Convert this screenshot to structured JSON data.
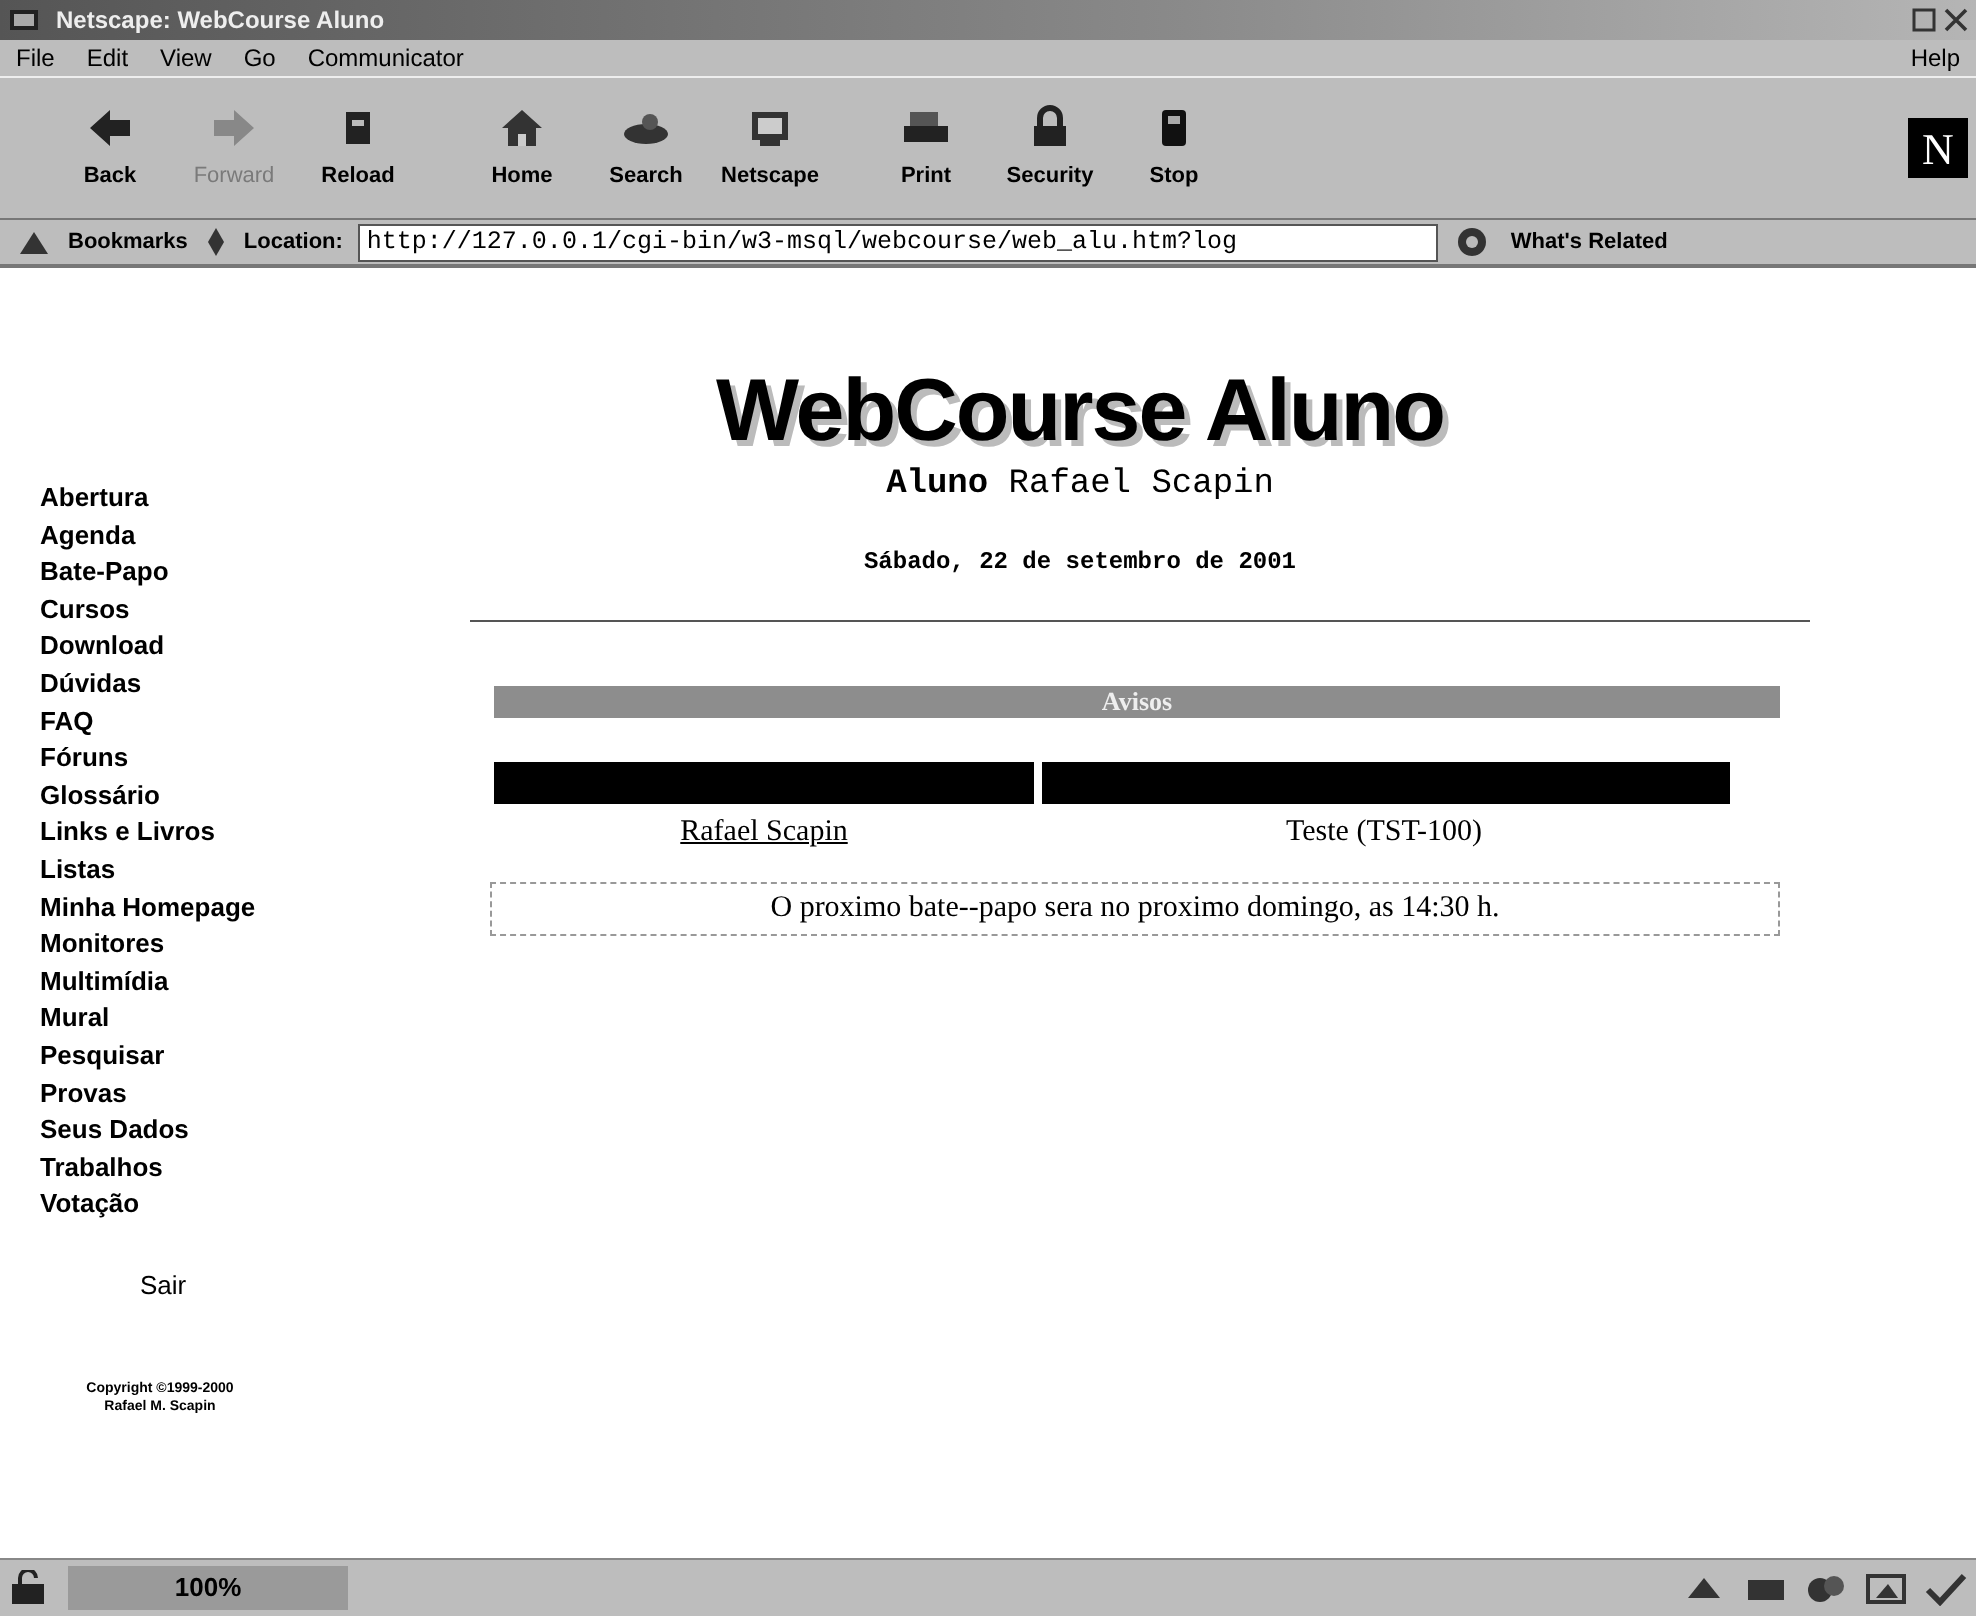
{
  "window": {
    "title": "Netscape: WebCourse Aluno"
  },
  "menu": [
    "File",
    "Edit",
    "View",
    "Go",
    "Communicator"
  ],
  "help_menu": "Help",
  "toolbar": [
    {
      "label": "Back",
      "disabled": false
    },
    {
      "label": "Forward",
      "disabled": true
    },
    {
      "label": "Reload",
      "disabled": false
    },
    {
      "label": "Home",
      "disabled": false
    },
    {
      "label": "Search",
      "disabled": false
    },
    {
      "label": "Netscape",
      "disabled": false
    },
    {
      "label": "Print",
      "disabled": false
    },
    {
      "label": "Security",
      "disabled": false
    },
    {
      "label": "Stop",
      "disabled": false
    }
  ],
  "logo": "N",
  "location_bar": {
    "bookmarks": "Bookmarks",
    "location_label": "Location:",
    "url": "http://127.0.0.1/cgi-bin/w3-msql/webcourse/web_alu.htm?log",
    "related": "What's Related"
  },
  "page": {
    "heading": "WebCourse Aluno",
    "student_label": "Aluno",
    "student_name": "Rafael Scapin",
    "date": "Sábado, 22 de setembro de 2001",
    "nav": [
      "Abertura",
      "Agenda",
      "Bate-Papo",
      "Cursos",
      "Download",
      "Dúvidas",
      "FAQ",
      "Fóruns",
      "Glossário",
      "Links e Livros",
      "Listas",
      "Minha Homepage",
      "Monitores",
      "Multimídia",
      "Mural",
      "Pesquisar",
      "Provas",
      "Seus Dados",
      "Trabalhos",
      "Votação"
    ],
    "logout": "Sair",
    "copyright": [
      "Copyright ©1999-2000",
      "Rafael M. Scapin"
    ],
    "notices": {
      "title": "Avisos",
      "rows": [
        {
          "author": "Rafael Scapin",
          "course": "Teste (TST-100)"
        }
      ],
      "message": "O proximo bate--papo sera no proximo domingo, as 14:30 h."
    }
  },
  "status_bar": {
    "progress": "100%"
  }
}
